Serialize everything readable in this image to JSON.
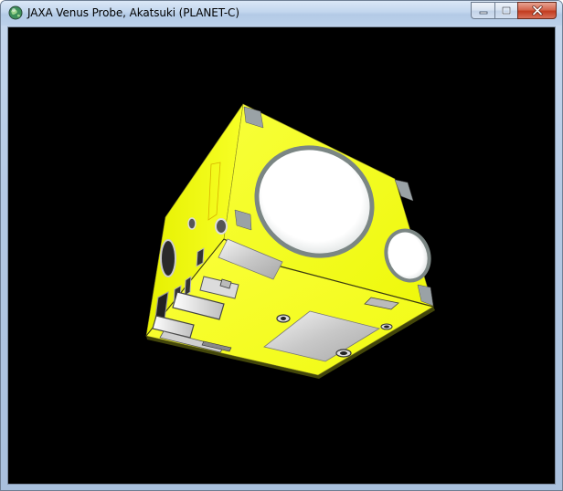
{
  "window": {
    "title": "JAXA Venus Probe, Akatsuki (PLANET-C)",
    "icon": "globe-icon",
    "buttons": {
      "minimize": "minimize-icon",
      "maximize": "maximize-icon",
      "close": "close-icon"
    }
  },
  "viewport": {
    "background_color": "#000000",
    "model": {
      "name": "Akatsuki spacecraft body",
      "body_color": "#f5ff1e"
    }
  }
}
